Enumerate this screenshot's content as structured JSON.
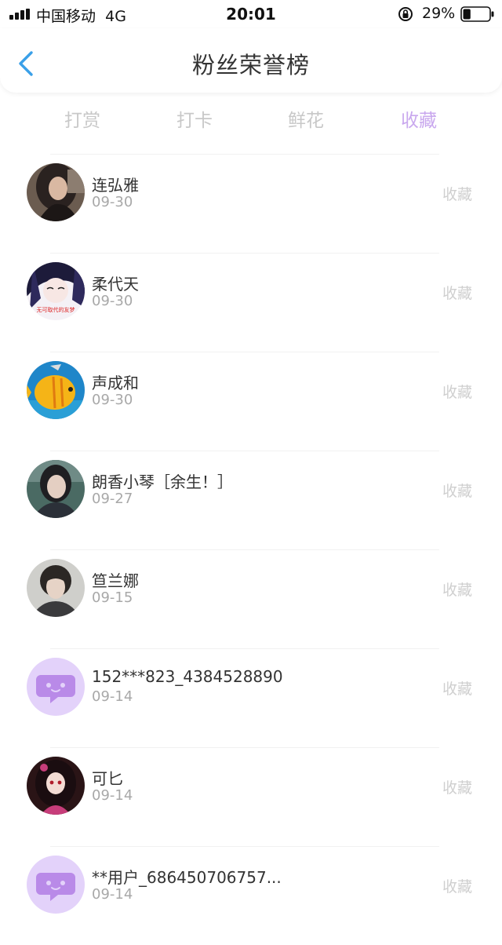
{
  "status_bar": {
    "carrier": "中国移动",
    "network": "4G",
    "time": "20:01",
    "battery_percent": "29%",
    "battery_level": 0.29
  },
  "header": {
    "title": "粉丝荣誉榜"
  },
  "tabs": [
    {
      "label": "打赏",
      "active": false
    },
    {
      "label": "打卡",
      "active": false
    },
    {
      "label": "鲜花",
      "active": false
    },
    {
      "label": "收藏",
      "active": true
    }
  ],
  "colors": {
    "accent": "#c9a8ee",
    "back_arrow": "#3aa0e8",
    "inactive_text": "#c8c8c8",
    "default_avatar_bg": "#e3d2fa"
  },
  "fans": [
    {
      "name": "连弘雅",
      "date": "09-30",
      "action": "收藏",
      "avatar": "photo-dark-hair"
    },
    {
      "name": "柔代天",
      "date": "09-30",
      "action": "收藏",
      "avatar": "photo-anime-girl",
      "avatar_caption": "无可取代的友梦"
    },
    {
      "name": "声成和",
      "date": "09-30",
      "action": "收藏",
      "avatar": "photo-yellow-fish"
    },
    {
      "name": "朗香小琴［余生！］",
      "date": "09-27",
      "action": "收藏",
      "avatar": "photo-woman-outdoor"
    },
    {
      "name": "笪兰娜",
      "date": "09-15",
      "action": "收藏",
      "avatar": "photo-young-man"
    },
    {
      "name": "152***823_4384528890",
      "date": "09-14",
      "action": "收藏",
      "avatar": "default-chat-bubble"
    },
    {
      "name": "可匕",
      "date": "09-14",
      "action": "收藏",
      "avatar": "photo-anime-dark"
    },
    {
      "name": "**用户_686450706757...",
      "date": "09-14",
      "action": "收藏",
      "avatar": "default-chat-bubble"
    }
  ]
}
